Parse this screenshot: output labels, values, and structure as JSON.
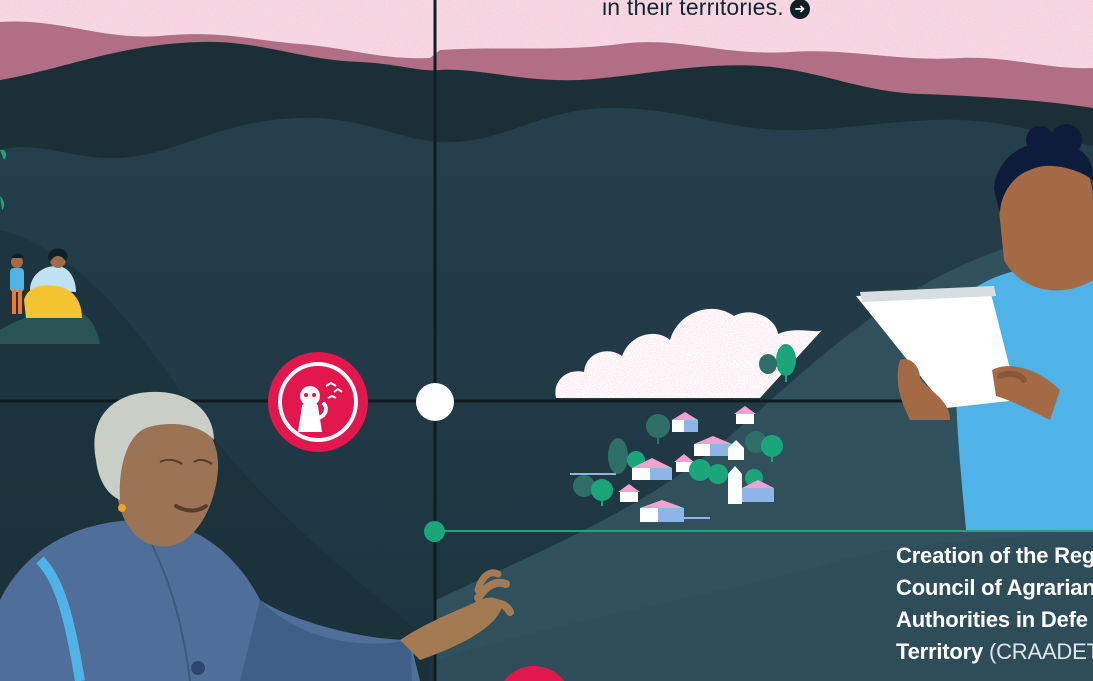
{
  "header": {
    "caption": "in their territories.",
    "arrow_icon": "arrow-right-circle-icon"
  },
  "milestone": {
    "title_line1": "Creation of the Reg",
    "title_line2": "Council of Agrarian",
    "title_line3": "Authorities in Defe",
    "title_line4": "Territory",
    "abbreviation": "(CRAADET"
  },
  "badge": {
    "icon": "monkey-birds-icon",
    "color": "#e2174d"
  },
  "colors": {
    "sky_pink": "#f4c9d8",
    "mountain_pink": "#b06f84",
    "night_teal": "#1f3a45",
    "accent_red": "#e2174d",
    "accent_green": "#1aa67a"
  }
}
